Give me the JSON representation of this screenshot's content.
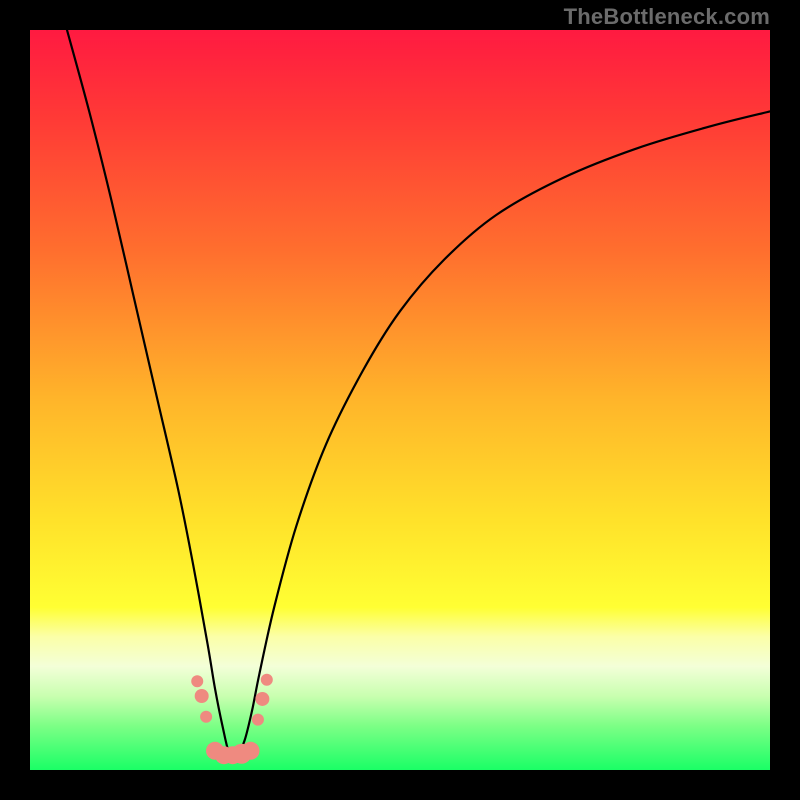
{
  "watermark": "TheBottleneck.com",
  "chart_data": {
    "type": "line",
    "title": "",
    "xlabel": "",
    "ylabel": "",
    "xlim": [
      0,
      100
    ],
    "ylim": [
      0,
      100
    ],
    "x_optimum": 27,
    "gradient_stops": [
      {
        "offset": 0,
        "color": "#ff1a41"
      },
      {
        "offset": 0.12,
        "color": "#ff3a36"
      },
      {
        "offset": 0.3,
        "color": "#ff6f2e"
      },
      {
        "offset": 0.5,
        "color": "#ffb52a"
      },
      {
        "offset": 0.66,
        "color": "#ffe12a"
      },
      {
        "offset": 0.78,
        "color": "#ffff33"
      },
      {
        "offset": 0.82,
        "color": "#fbffa8"
      },
      {
        "offset": 0.86,
        "color": "#f3ffd8"
      },
      {
        "offset": 0.9,
        "color": "#c9ffb0"
      },
      {
        "offset": 0.94,
        "color": "#7dff86"
      },
      {
        "offset": 1.0,
        "color": "#1aff66"
      }
    ],
    "series": [
      {
        "name": "bottleneck-curve",
        "x": [
          5,
          8,
          11,
          14,
          17,
          20,
          22,
          24,
          25,
          26,
          27,
          28,
          29,
          30,
          31,
          33,
          36,
          40,
          45,
          50,
          56,
          63,
          72,
          82,
          92,
          100
        ],
        "y": [
          100,
          89,
          77,
          64,
          51,
          38,
          28,
          17,
          11,
          6,
          2,
          2,
          4,
          8,
          13,
          22,
          33,
          44,
          54,
          62,
          69,
          75,
          80,
          84,
          87,
          89
        ]
      }
    ],
    "markers": {
      "name": "highlight-cluster",
      "color": "#ef8a80",
      "points": [
        {
          "x": 22.6,
          "y": 12.0,
          "r": 6
        },
        {
          "x": 23.2,
          "y": 10.0,
          "r": 7
        },
        {
          "x": 23.8,
          "y": 7.2,
          "r": 6
        },
        {
          "x": 25.0,
          "y": 2.6,
          "r": 9
        },
        {
          "x": 26.2,
          "y": 2.0,
          "r": 9
        },
        {
          "x": 27.4,
          "y": 2.0,
          "r": 9
        },
        {
          "x": 28.6,
          "y": 2.2,
          "r": 10
        },
        {
          "x": 29.8,
          "y": 2.6,
          "r": 9
        },
        {
          "x": 30.8,
          "y": 6.8,
          "r": 6
        },
        {
          "x": 31.4,
          "y": 9.6,
          "r": 7
        },
        {
          "x": 32.0,
          "y": 12.2,
          "r": 6
        }
      ]
    }
  }
}
